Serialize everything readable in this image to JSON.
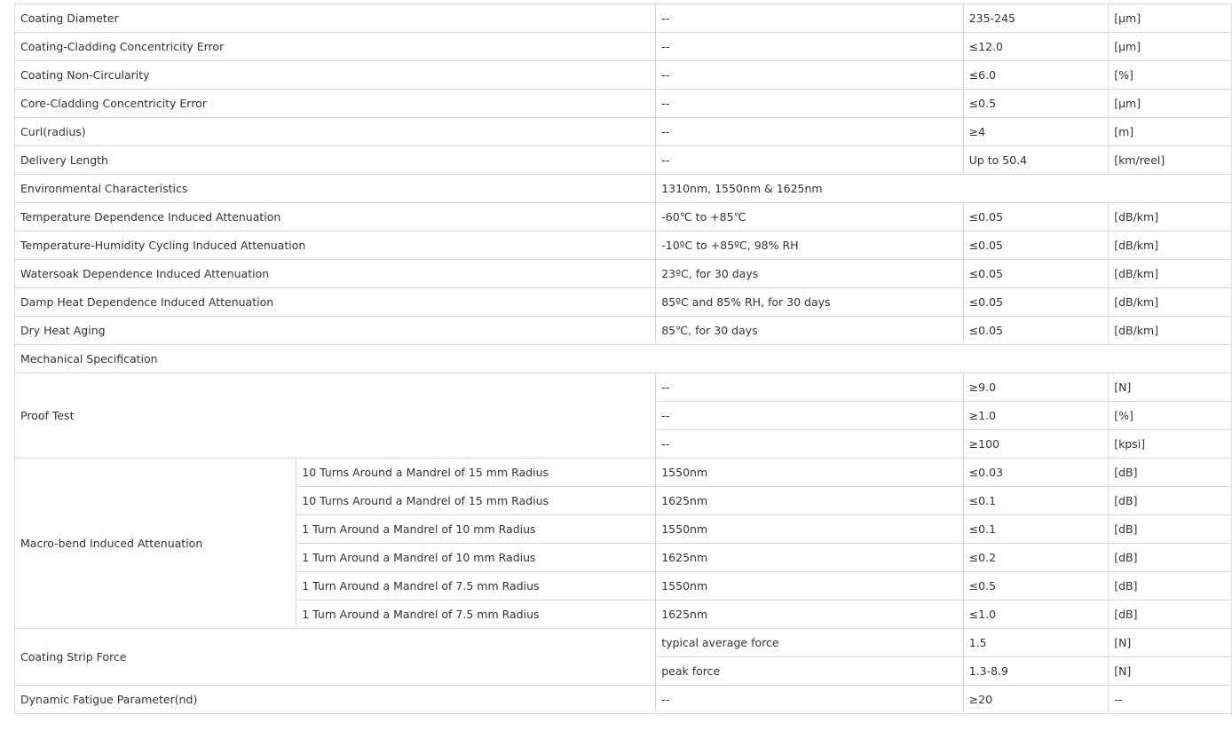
{
  "rows": [
    {
      "param": "Coating Diameter",
      "cond": "--",
      "value": "235-245",
      "unit": "[μm]"
    },
    {
      "param": "Coating-Cladding Concentricity Error",
      "cond": "--",
      "value": "≤12.0",
      "unit": "[μm]"
    },
    {
      "param": "Coating Non-Circularity",
      "cond": "--",
      "value": "≤6.0",
      "unit": "[%]"
    },
    {
      "param": "Core-Cladding Concentricity Error",
      "cond": "--",
      "value": "≤0.5",
      "unit": "[μm]"
    },
    {
      "param": "Curl(radius)",
      "cond": "--",
      "value": "≥4",
      "unit": "[m]"
    },
    {
      "param": "Delivery Length",
      "cond": "--",
      "value": "Up to 50.4",
      "unit": "[km/reel]"
    }
  ],
  "environmental": {
    "title": "Environmental Characteristics",
    "wavelengths": "1310nm, 1550nm & 1625nm",
    "rows": [
      {
        "param": "Temperature Dependence Induced Attenuation",
        "cond": "-60℃ to +85℃",
        "value": "≤0.05",
        "unit": "[dB/km]"
      },
      {
        "param": "Temperature-Humidity Cycling Induced Attenuation",
        "cond": "-10ºC to +85ºC, 98% RH",
        "value": "≤0.05",
        "unit": "[dB/km]"
      },
      {
        "param": "Watersoak Dependence Induced Attenuation",
        "cond": "23ºC, for 30 days",
        "value": "≤0.05",
        "unit": "[dB/km]"
      },
      {
        "param": "Damp Heat Dependence Induced Attenuation",
        "cond": "85ºC and 85% RH, for 30 days",
        "value": "≤0.05",
        "unit": "[dB/km]"
      },
      {
        "param": "Dry Heat Aging",
        "cond": "85℃, for 30 days",
        "value": "≤0.05",
        "unit": "[dB/km]"
      }
    ]
  },
  "mechanical": {
    "title": "Mechanical Specification",
    "proof_test": {
      "label": "Proof Test",
      "rows": [
        {
          "cond": "--",
          "value": "≥9.0",
          "unit": "[N]"
        },
        {
          "cond": "--",
          "value": "≥1.0",
          "unit": "[%]"
        },
        {
          "cond": "--",
          "value": "≥100",
          "unit": "[kpsi]"
        }
      ]
    },
    "macro_bend": {
      "label": "Macro-bend Induced Attenuation",
      "rows": [
        {
          "sub": "10 Turns Around a Mandrel of 15 mm Radius",
          "cond": "1550nm",
          "value": "≤0.03",
          "unit": "[dB]"
        },
        {
          "sub": "10 Turns Around a Mandrel of 15 mm Radius",
          "cond": "1625nm",
          "value": "≤0.1",
          "unit": "[dB]"
        },
        {
          "sub": "1 Turn Around a Mandrel of 10 mm Radius",
          "cond": "1550nm",
          "value": "≤0.1",
          "unit": "[dB]"
        },
        {
          "sub": "1 Turn Around a Mandrel of 10 mm Radius",
          "cond": "1625nm",
          "value": "≤0.2",
          "unit": "[dB]"
        },
        {
          "sub": "1 Turn Around a Mandrel of 7.5 mm Radius",
          "cond": "1550nm",
          "value": "≤0.5",
          "unit": "[dB]"
        },
        {
          "sub": "1 Turn Around a Mandrel of 7.5 mm Radius",
          "cond": "1625nm",
          "value": "≤1.0",
          "unit": "[dB]"
        }
      ]
    },
    "strip_force": {
      "label": "Coating Strip Force",
      "rows": [
        {
          "cond": "typical average force",
          "value": "1.5",
          "unit": "[N]"
        },
        {
          "cond": "peak force",
          "value": "1.3-8.9",
          "unit": "[N]"
        }
      ]
    },
    "dynamic_fatigue": {
      "param": "Dynamic Fatigue Parameter(nd)",
      "cond": "--",
      "value": "≥20",
      "unit": "--"
    }
  }
}
